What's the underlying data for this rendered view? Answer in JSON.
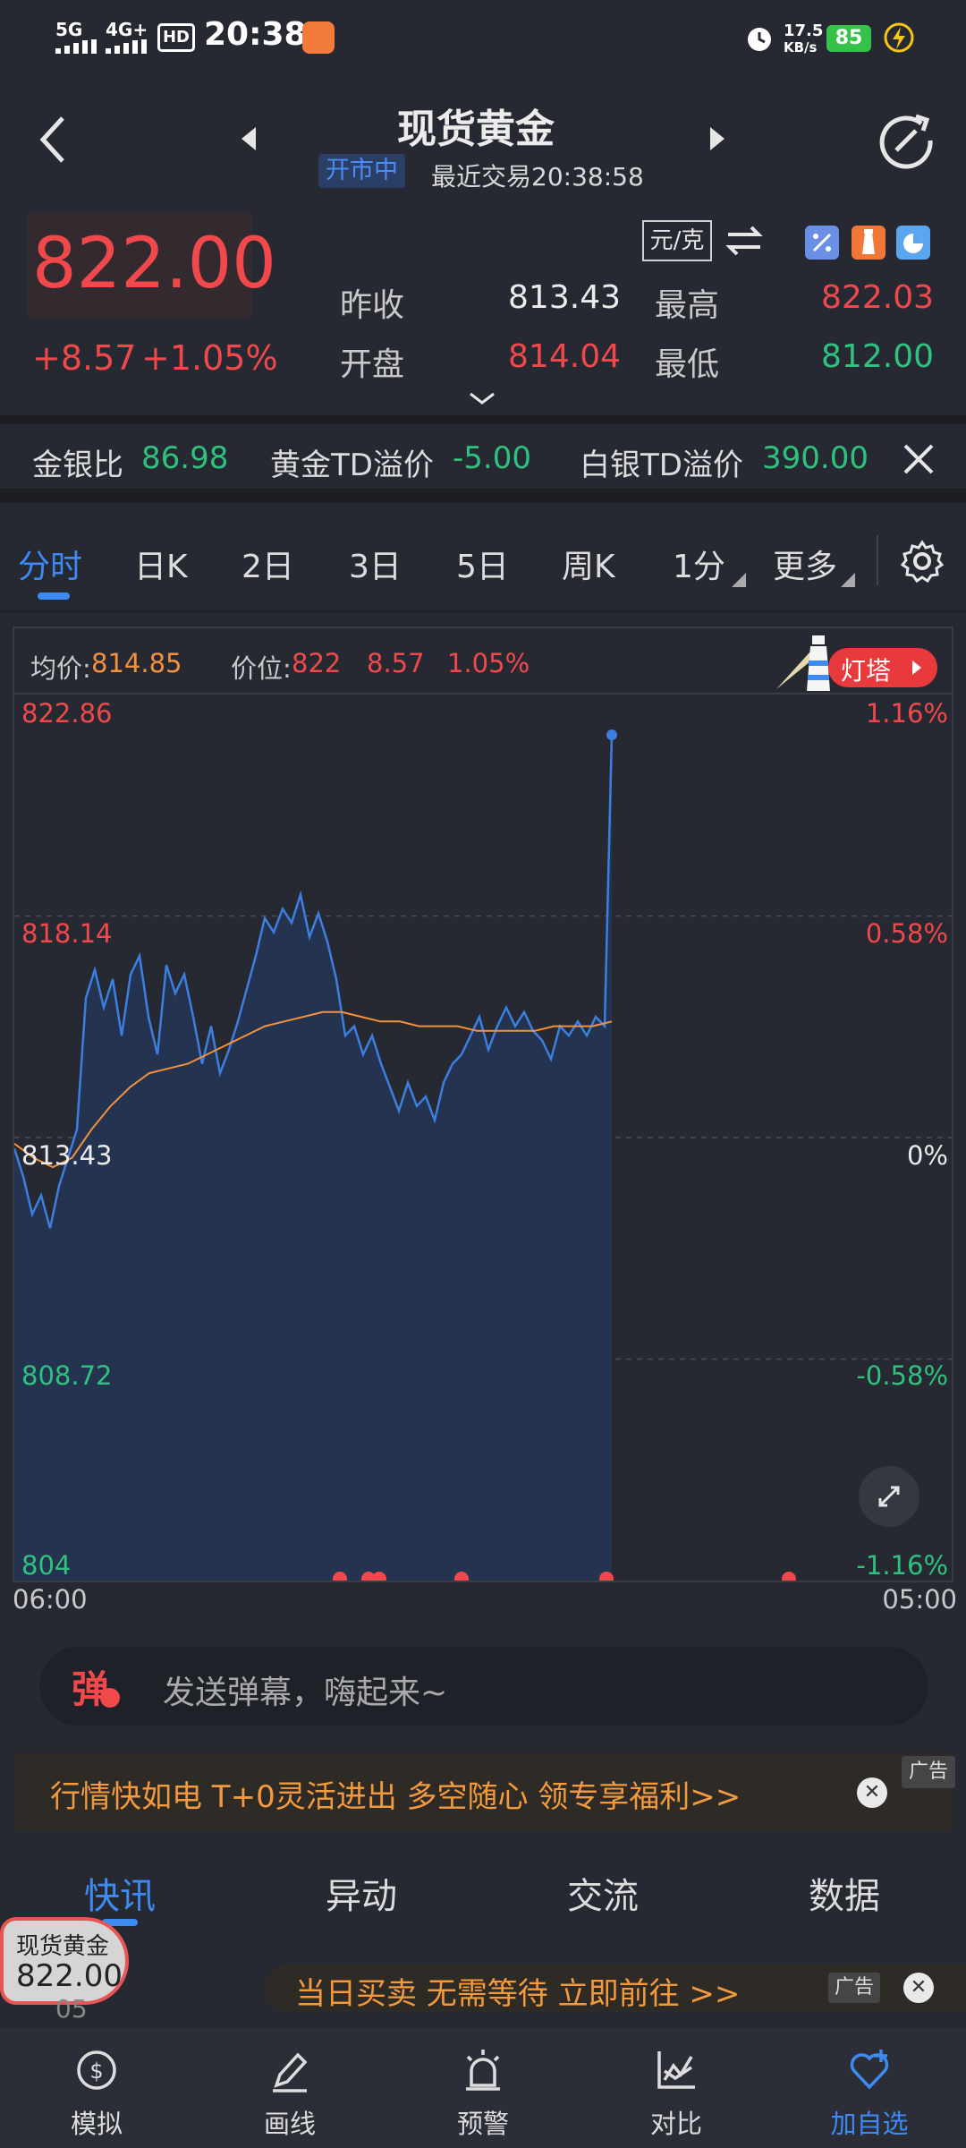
{
  "status_bar": {
    "network": "5G",
    "network2": "4G+",
    "hd": "HD",
    "time": "20:38",
    "speed_value": "17.5",
    "speed_unit": "KB/s",
    "battery": "85"
  },
  "header": {
    "title": "现货黄金",
    "market_status": "开市中",
    "last_trade": "最近交易20:38:58"
  },
  "quote": {
    "price": "822.00",
    "change": "+8.57",
    "change_pct": "+1.05%",
    "unit": "元/克",
    "stats": [
      {
        "label": "昨收",
        "value": "813.43",
        "color": "#ececec"
      },
      {
        "label": "最高",
        "value": "822.03",
        "color": "#f0484b"
      },
      {
        "label": "开盘",
        "value": "814.04",
        "color": "#f0484b"
      },
      {
        "label": "最低",
        "value": "812.00",
        "color": "#2ec27e"
      }
    ]
  },
  "ratios": [
    {
      "label": "金银比",
      "value": "86.98"
    },
    {
      "label": "黄金TD溢价",
      "value": "-5.00"
    },
    {
      "label": "白银TD溢价",
      "value": "390.00"
    }
  ],
  "chart_tabs": [
    "分时",
    "日K",
    "2日",
    "3日",
    "5日",
    "周K",
    "1分",
    "更多"
  ],
  "chart_info": {
    "avg_label": "均价:",
    "avg_value": "814.85",
    "pos_label": "价位:",
    "pos_value": "822",
    "pos_change": "8.57",
    "pos_pct": "1.05%",
    "lighthouse": "灯塔"
  },
  "chart_data": {
    "type": "line",
    "x_ticks": [
      "06:00",
      "05:00"
    ],
    "y_left_ticks": [
      "822.86",
      "818.14",
      "813.43",
      "808.72",
      "804"
    ],
    "y_right_ticks": [
      "1.16%",
      "0.58%",
      "0%",
      "-0.58%",
      "-1.16%"
    ],
    "ylim": [
      804,
      822.86
    ],
    "baseline": 813.43,
    "series": [
      {
        "values": [
          813.2,
          812.6,
          811.8,
          812.2,
          811.5,
          812.4,
          813.0,
          813.6,
          816.4,
          817.0,
          816.2,
          816.8,
          815.6,
          816.9,
          817.3,
          816.0,
          815.2,
          817.1,
          816.5,
          816.9,
          816.0,
          815.0,
          815.8,
          814.8,
          815.3,
          815.9,
          816.6,
          817.3,
          818.1,
          817.8,
          818.3,
          818.0,
          818.6,
          817.7,
          818.2,
          817.6,
          816.8,
          815.6,
          815.8,
          815.2,
          815.6,
          815.0,
          814.5,
          814.0,
          814.6,
          814.1,
          814.3,
          813.8,
          814.6,
          815.0,
          815.2,
          815.6,
          816.0,
          815.3,
          815.8,
          816.2,
          815.8,
          816.1,
          815.7,
          815.5,
          815.1,
          815.8,
          815.6,
          815.9,
          815.6,
          816.0,
          815.8,
          822.0
        ],
        "color": "#3d7fe0"
      },
      {
        "values": [
          813.3,
          813.0,
          812.8,
          813.0,
          813.6,
          814.1,
          814.5,
          814.8,
          814.9,
          815.0,
          815.2,
          815.4,
          815.6,
          815.8,
          815.9,
          816.0,
          816.1,
          816.1,
          816.0,
          815.9,
          815.9,
          815.8,
          815.8,
          815.8,
          815.7,
          815.7,
          815.7,
          815.7,
          815.8,
          815.8,
          815.8,
          815.9
        ],
        "color": "#f3913d"
      }
    ]
  },
  "danmaku": {
    "icon_char": "弹",
    "placeholder": "发送弹幕，嗨起来~"
  },
  "ad1": {
    "text": "行情快如电  T+0灵活进出  多空随心  领专享福利>>",
    "tag": "广告"
  },
  "news_tabs": [
    "快讯",
    "异动",
    "交流",
    "数据"
  ],
  "ad2": {
    "text": "当日买卖  无需等待  立即前往  >>",
    "tag": "广告"
  },
  "float_widget": {
    "name": "现货黄金",
    "price": "822.00",
    "sub": "05"
  },
  "bottom_nav": [
    "模拟",
    "画线",
    "预警",
    "对比",
    "加自选"
  ]
}
